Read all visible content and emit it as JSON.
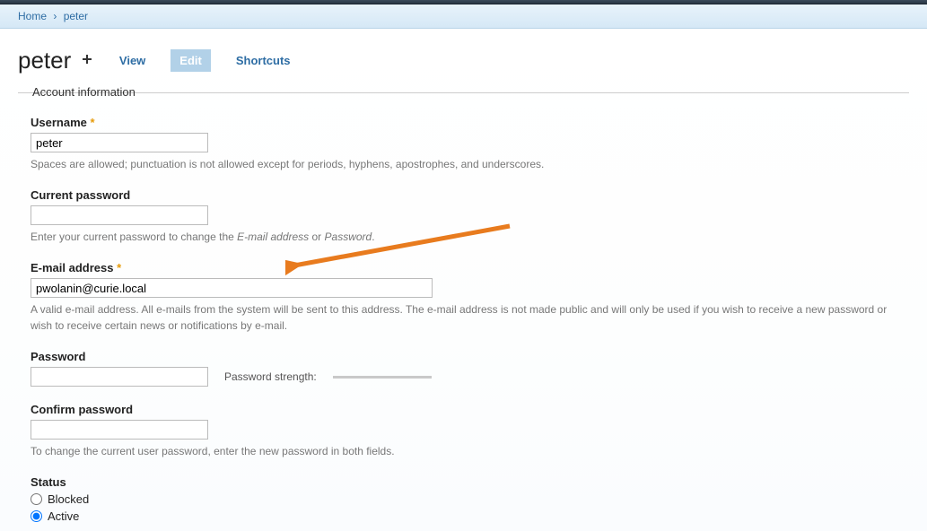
{
  "breadcrumb": {
    "home": "Home",
    "sep": "›",
    "current": "peter"
  },
  "page_title": "peter",
  "tabs": {
    "view": "View",
    "edit": "Edit",
    "shortcuts": "Shortcuts"
  },
  "fieldset_legend": "Account information",
  "form": {
    "username": {
      "label": "Username",
      "required": "*",
      "value": "peter",
      "help": "Spaces are allowed; punctuation is not allowed except for periods, hyphens, apostrophes, and underscores."
    },
    "current_password": {
      "label": "Current password",
      "value": "",
      "help_pre": "Enter your current password to change the ",
      "help_em1": "E-mail address",
      "help_mid": " or ",
      "help_em2": "Password",
      "help_post": "."
    },
    "email": {
      "label": "E-mail address",
      "required": "*",
      "value": "pwolanin@curie.local",
      "help": "A valid e-mail address. All e-mails from the system will be sent to this address. The e-mail address is not made public and will only be used if you wish to receive a new password or wish to receive certain news or notifications by e-mail."
    },
    "password": {
      "label": "Password",
      "value": "",
      "strength_label": "Password strength:"
    },
    "confirm_password": {
      "label": "Confirm password",
      "value": "",
      "help": "To change the current user password, enter the new password in both fields."
    },
    "status": {
      "label": "Status",
      "options": {
        "blocked": "Blocked",
        "active": "Active"
      },
      "selected": "active"
    }
  },
  "annotation": {
    "arrow_color": "#e87b1e"
  }
}
